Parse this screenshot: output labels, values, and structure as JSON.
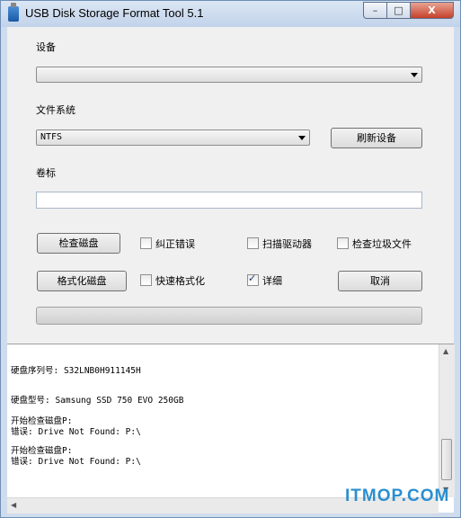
{
  "window": {
    "title": "USB Disk Storage Format Tool 5.1"
  },
  "titlebar_buttons": {
    "minimize": "–",
    "maximize": "□",
    "close": "X"
  },
  "form": {
    "device_label": "设备",
    "device_value": "",
    "filesystem_label": "文件系统",
    "filesystem_value": "NTFS",
    "refresh_label": "刷新设备",
    "volume_label": "卷标",
    "volume_value": "",
    "check_disk_label": "检查磁盘",
    "format_disk_label": "格式化磁盘",
    "cancel_label": "取消",
    "checkboxes": {
      "fix_errors": {
        "label": "纠正错误",
        "checked": false
      },
      "scan_drive": {
        "label": "扫描驱动器",
        "checked": false
      },
      "check_junk": {
        "label": "检查垃圾文件",
        "checked": false
      },
      "quick_format": {
        "label": "快速格式化",
        "checked": false
      },
      "verbose": {
        "label": "详细",
        "checked": true
      }
    },
    "progress": 0
  },
  "log": {
    "lines": [
      "硬盘序列号: S32LNB0H911145H",
      "硬盘型号: Samsung SSD 750 EVO 250GB",
      "开始检查磁盘P:",
      "错误: Drive Not Found: P:\\",
      "开始检查磁盘P:",
      "错误: Drive Not Found: P:\\"
    ]
  },
  "watermark": "ITMOP.COM"
}
